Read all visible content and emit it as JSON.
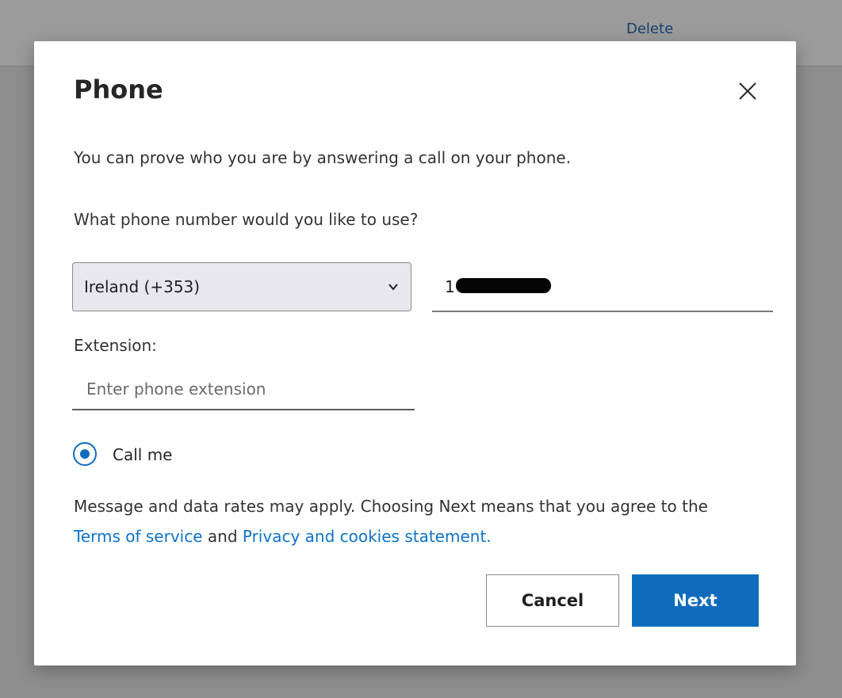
{
  "background": {
    "link_label": "Delete"
  },
  "dialog": {
    "title": "Phone",
    "intro": "You can prove who you are by answering a call on your phone.",
    "question": "What phone number would you like to use?",
    "country_select": {
      "selected": "Ireland (+353)"
    },
    "phone_input": {
      "visible_prefix": "1"
    },
    "extension": {
      "label": "Extension:",
      "placeholder": "Enter phone extension",
      "value": ""
    },
    "method_option": {
      "label": "Call me",
      "selected": true
    },
    "disclaimer": {
      "text_before": "Message and data rates may apply. Choosing Next means that you agree to the ",
      "terms_link": "Terms of service",
      "text_middle": " and ",
      "privacy_link": "Privacy and cookies statement."
    },
    "buttons": {
      "cancel": "Cancel",
      "next": "Next"
    }
  },
  "colors": {
    "accent": "#0f6cbd",
    "link": "#0e73c7",
    "overlay": "#8f8f8f",
    "dialog_bg": "#ffffff",
    "select_bg": "#e9e7ee"
  },
  "icons": {
    "close": "close-icon",
    "select_arrow": "chevron-down-icon"
  }
}
